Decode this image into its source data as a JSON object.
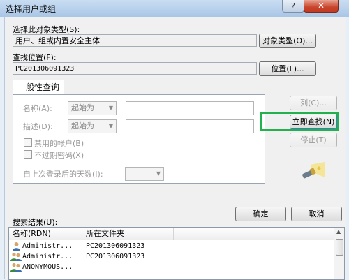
{
  "window": {
    "title": "选择用户或组",
    "help_symbol": "?",
    "close_symbol": "✕"
  },
  "object_type": {
    "label": "选择此对象类型(S):",
    "value": "用户、组或内置安全主体",
    "button": "对象类型(O)..."
  },
  "location": {
    "label": "查找位置(F):",
    "value": "PC201306091323",
    "button": "位置(L)..."
  },
  "tab": {
    "label": "一般性查询",
    "name_label": "名称(A):",
    "name_mode": "起始为",
    "desc_label": "描述(D):",
    "desc_mode": "起始为",
    "disabled_accounts": "禁用的帐户(B)",
    "no_expire_password": "不过期密码(X)",
    "days_since_logon": "自上次登录后的天数(I):"
  },
  "side_buttons": {
    "columns": "列(C)...",
    "find_now": "立即查找(N)",
    "stop": "停止(T)"
  },
  "footer": {
    "ok": "确定",
    "cancel": "取消",
    "results_label": "搜索结果(U):"
  },
  "results": {
    "columns": [
      "名称(RDN)",
      "所在文件夹"
    ],
    "rows": [
      {
        "name": "Administr...",
        "folder": "PC201306091323",
        "icon": "user-icon"
      },
      {
        "name": "Administr...",
        "folder": "PC201306091323",
        "icon": "group-icon"
      },
      {
        "name": "ANONYMOUS...",
        "folder": "",
        "icon": "group-icon"
      }
    ]
  },
  "colors": {
    "highlight": "#22b14c",
    "close_button": "#c9452b"
  }
}
